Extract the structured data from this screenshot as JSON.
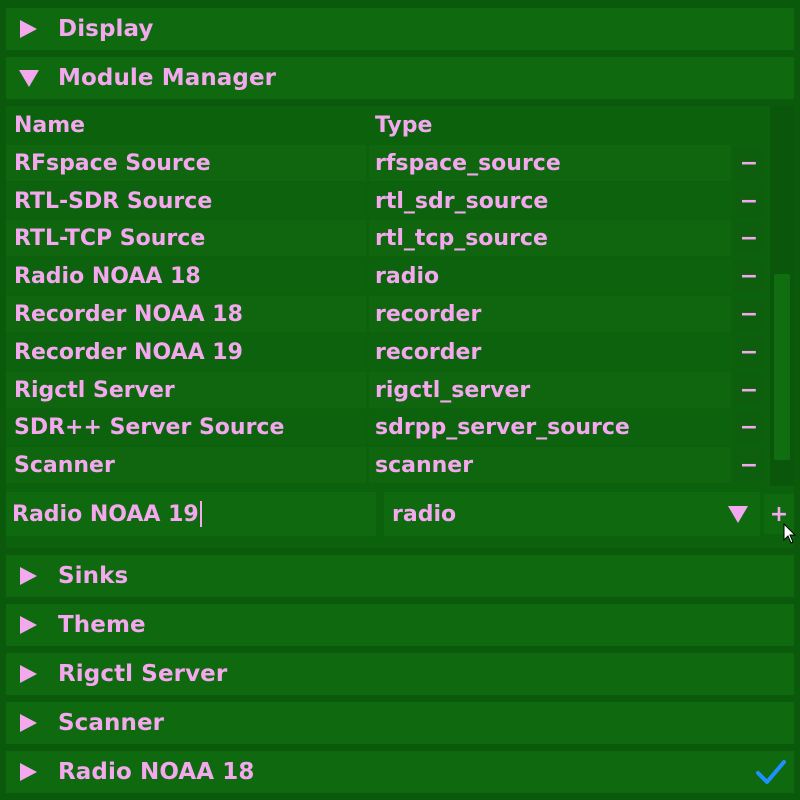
{
  "colors": {
    "background": "#0b5a0b",
    "text": "#f4a9ef",
    "check": "#1e90ff"
  },
  "sections": {
    "display": {
      "label": "Display",
      "expanded": false
    },
    "module_manager": {
      "label": "Module Manager",
      "expanded": true
    },
    "sinks": {
      "label": "Sinks",
      "expanded": false
    },
    "theme": {
      "label": "Theme",
      "expanded": false
    },
    "rigctl_server": {
      "label": "Rigctl Server",
      "expanded": false
    },
    "scanner": {
      "label": "Scanner",
      "expanded": false
    },
    "radio_noaa_18": {
      "label": "Radio NOAA 18",
      "expanded": false,
      "enabled": true
    }
  },
  "module_manager": {
    "columns": {
      "name": "Name",
      "type": "Type"
    },
    "remove_label": "−",
    "rows": [
      {
        "name": "RFspace Source",
        "type": "rfspace_source"
      },
      {
        "name": "RTL-SDR Source",
        "type": "rtl_sdr_source"
      },
      {
        "name": "RTL-TCP Source",
        "type": "rtl_tcp_source"
      },
      {
        "name": "Radio NOAA 18",
        "type": "radio"
      },
      {
        "name": "Recorder NOAA 18",
        "type": "recorder"
      },
      {
        "name": "Recorder NOAA 19",
        "type": "recorder"
      },
      {
        "name": "Rigctl Server",
        "type": "rigctl_server"
      },
      {
        "name": "SDR++ Server Source",
        "type": "sdrpp_server_source"
      },
      {
        "name": "Scanner",
        "type": "scanner"
      }
    ],
    "new_module": {
      "name_value": "Radio NOAA 19",
      "type_value": "radio",
      "add_label": "+"
    }
  },
  "icons": {
    "collapsed": "triangle-right-icon",
    "expanded": "triangle-down-icon",
    "dropdown": "triangle-down-icon",
    "enabled": "checkmark-icon",
    "pointer": "mouse-cursor-icon"
  }
}
